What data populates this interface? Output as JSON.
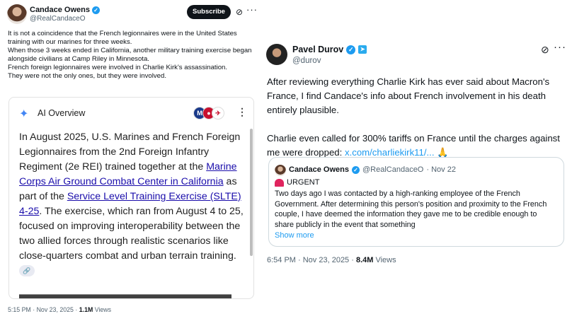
{
  "left_post": {
    "author_name": "Candace Owens",
    "author_handle": "@RealCandaceO",
    "subscribe_label": "Subscribe",
    "more_glyph": "···",
    "grok_glyph": "⊘",
    "paragraphs": [
      "It is not a coincidence that the French legionnaires were in the United States training with our marines for three weeks.",
      "When those 3 weeks ended in California, another military training exercise began alongside civilians at Camp Riley in Minnesota.",
      "French foreign legionnaires were involved in Charlie Kirk's assassination.",
      "They were not the only ones, but they were involved."
    ],
    "ai_overview": {
      "title": "AI Overview",
      "star_icon": "sparkle-icon",
      "more_glyph": "⋮",
      "text_1": "In August 2025, U.S. Marines and French Foreign Legionnaires from the 2nd Foreign Infantry Regiment (2e REI) trained together at the ",
      "link_1": "Marine Corps Air Ground Combat Center in California",
      "text_2": " as part of the ",
      "link_2": "Service Level Training Exercise (SLTE) 4-25",
      "text_3": ". The exercise, which ran from August 4 to 25, focused on improving interoperability between the two allied forces through realistic scenarios like close-quarters combat and urban terrain training. ",
      "link_chip": "🔗"
    },
    "time": "5:15 PM · Nov 23, 2025 · ",
    "views_count": "1.1M",
    "views_label": " Views"
  },
  "right_post": {
    "author_name": "Pavel Durov",
    "author_handle": "@durov",
    "more_glyph": "···",
    "grok_glyph": "⊘",
    "paragraph_1": "After reviewing everything Charlie Kirk has ever said about Macron's France, I find Candace's info about French involvement in his death entirely plausible.",
    "paragraph_2_text": "Charlie even called for 300% tariffs on France until the charges against me were dropped: ",
    "paragraph_2_link": "x.com/charliekirk11/...",
    "paragraph_2_emoji": " 🙏",
    "quote": {
      "author_name": "Candace Owens",
      "author_handle": "@RealCandaceO",
      "date": "· Nov 22",
      "urgent": "URGENT",
      "text": "Two days ago I was contacted by a high-ranking employee of the French Government. After determining this person's position and proximity to the French couple, I have deemed the information they gave me to be credible enough to share publicly in the event that something",
      "show_more": "Show more"
    },
    "time": "6:54 PM · Nov 23, 2025 · ",
    "views_count": "8.4M",
    "views_label": " Views"
  },
  "colors": {
    "link_blue": "#1d9bf0",
    "google_link": "#1a0dab",
    "verified": "#1d9bf0",
    "muted": "#536471"
  }
}
